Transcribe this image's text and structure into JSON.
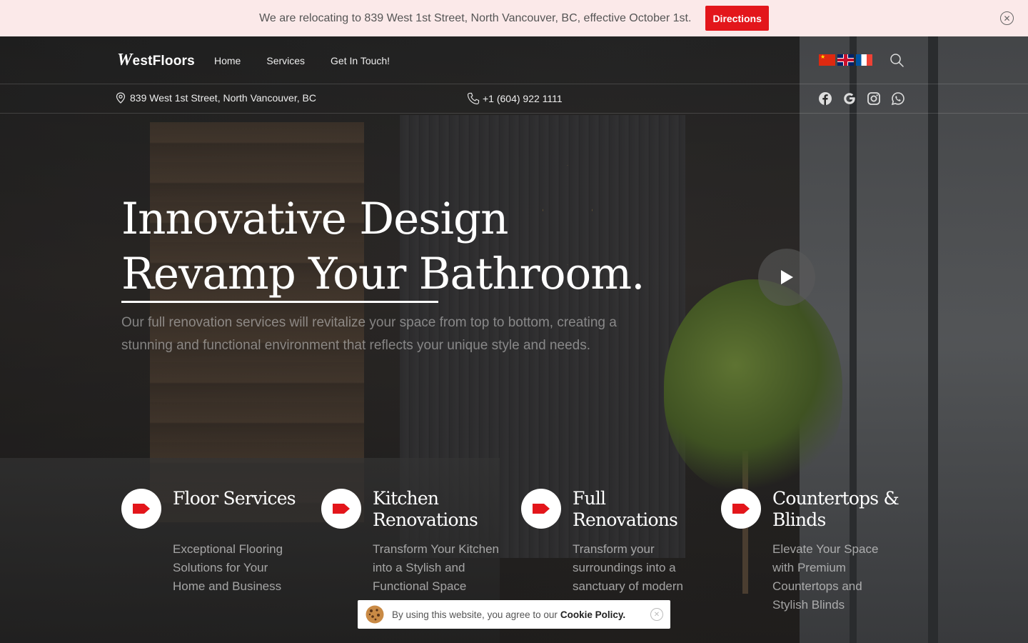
{
  "announcement": {
    "text": "We are relocating to 839 West 1st Street, North Vancouver, BC, effective October 1st.",
    "button_label": "Directions",
    "close_icon": "close-circle-icon"
  },
  "nav": {
    "logo_first": "W",
    "logo_rest": "estFloors",
    "links": [
      "Home",
      "Services",
      "Get In Touch!"
    ],
    "languages": [
      "chinese-flag-icon",
      "uk-flag-icon",
      "french-flag-icon"
    ],
    "search_icon": "search-icon"
  },
  "contact": {
    "address": "839 West 1st Street, North Vancouver, BC",
    "phone": "+1 (604) 922 1111",
    "socials": [
      "facebook-icon",
      "google-icon",
      "instagram-icon",
      "whatsapp-icon"
    ]
  },
  "hero": {
    "title_line1": "Innovative Design",
    "title_line2": "Revamp Your Bathroom.",
    "description": "Our full renovation services will revitalize your space from top to bottom, creating a stunning and functional environment that reflects your unique style and needs.",
    "play_icon": "play-icon"
  },
  "services": [
    {
      "title": "Floor Services",
      "description": "Exceptional Flooring Solutions for Your Home and Business"
    },
    {
      "title": "Kitchen Renovations",
      "description": "Transform Your Kitchen into a Stylish and Functional Space"
    },
    {
      "title": "Full Renovations",
      "description": "Transform your surroundings into a sanctuary of modern"
    },
    {
      "title": "Countertops & Blinds",
      "description": "Elevate Your Space with Premium Countertops and Stylish Blinds"
    }
  ],
  "cookie": {
    "text": "By using this website, you agree to our",
    "link": "Cookie Policy."
  },
  "colors": {
    "accent": "#e3161b",
    "announce_bg": "#fbe9e9"
  }
}
